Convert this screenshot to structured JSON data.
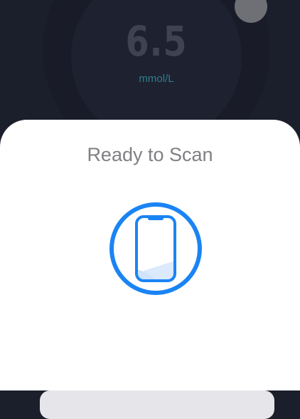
{
  "background_app": {
    "reading": {
      "value": "6.5",
      "unit": "mmol/L"
    }
  },
  "scan_sheet": {
    "title": "Ready to Scan",
    "icon": "phone-scan-icon",
    "accent_color": "#1a84f4"
  }
}
